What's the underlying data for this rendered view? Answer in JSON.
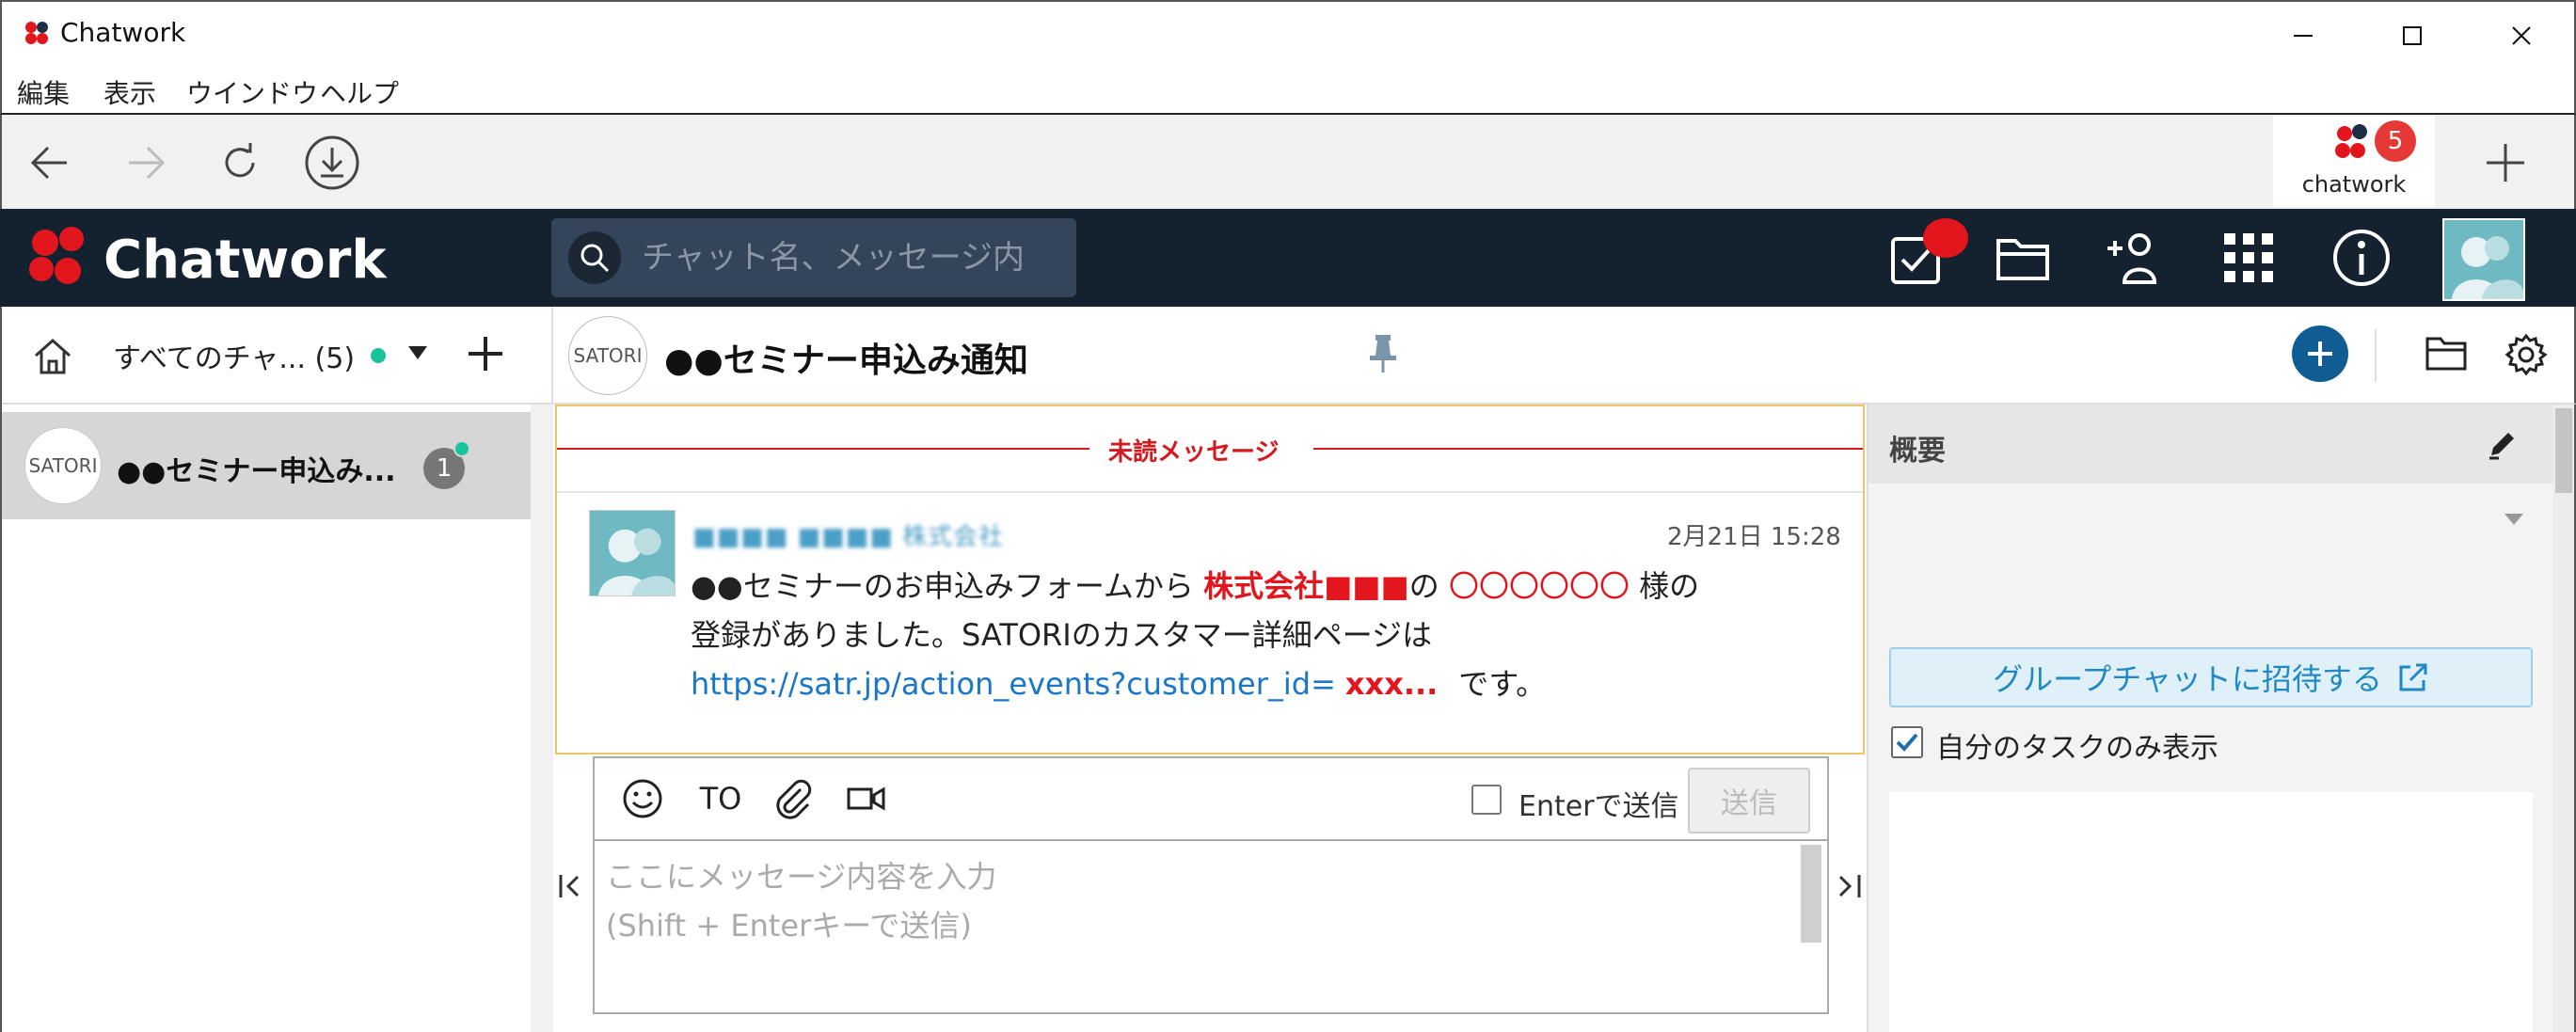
{
  "window": {
    "title": "Chatwork"
  },
  "menu": [
    "編集",
    "表示",
    "ウインドウ",
    "ヘルプ"
  ],
  "nav_tab": {
    "label": "chatwork",
    "badge": "5"
  },
  "app": {
    "brand": "Chatwork",
    "search_placeholder": "チャット名、メッセージ内"
  },
  "sidebar": {
    "filter_label": "すべてのチャ... (5)",
    "rooms": [
      {
        "avatar_text": "SATORI",
        "name": "●●セミナー申込み...",
        "unread": "1"
      }
    ]
  },
  "chat": {
    "avatar_text": "SATORI",
    "title": "●●セミナー申込み通知",
    "unread_label": "未読メッセージ",
    "message": {
      "sender": "■■■■ ■■■■ 株式会社",
      "time": "2月21日 15:28",
      "line1_a": "●●セミナーのお申込みフォームから ",
      "line1_company": "株式会社■■■",
      "line1_b": "の ",
      "line1_name": "〇〇〇〇〇〇",
      "line1_c": " 様の",
      "line2": "登録がありました。SATORIのカスタマー詳細ページは",
      "line3_link": "https://satr.jp/action_events?customer_id=",
      "line3_id": "xxx...",
      "line3_end": "です。"
    }
  },
  "composer": {
    "to_label": "TO",
    "enter_label": "Enterで送信",
    "send_label": "送信",
    "placeholder": "ここにメッセージ内容を入力\n(Shift + Enterキーで送信)"
  },
  "right_panel": {
    "title": "概要",
    "invite_label": "グループチャットに招待する",
    "task_filter_label": "自分のタスクのみ表示"
  },
  "colors": {
    "header_bg": "#14222f",
    "accent_red": "#e3161d",
    "link": "#1976c8",
    "unread_dot": "#19c49c"
  }
}
